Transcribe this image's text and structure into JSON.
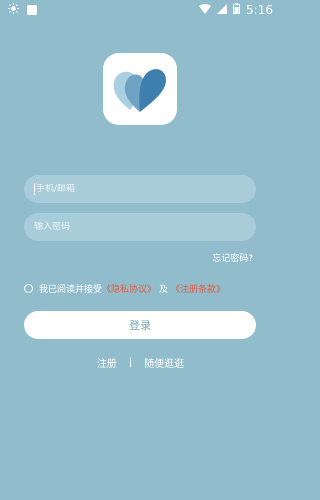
{
  "status_bar": {
    "time": "5:16"
  },
  "login": {
    "phone_placeholder": "手机/邮箱",
    "password_placeholder": "输入密码",
    "forgot_password": "忘记密码?",
    "agree_text": "我已阅读并接受",
    "privacy_link": "《隐私协议》",
    "and_text": "及",
    "terms_link": "《注册条款》",
    "login_button": "登录",
    "register_link": "注册",
    "separator": "|",
    "browse_link": "随便逛逛"
  },
  "colors": {
    "background": "#90bccb",
    "link_red": "#e85b3e"
  }
}
